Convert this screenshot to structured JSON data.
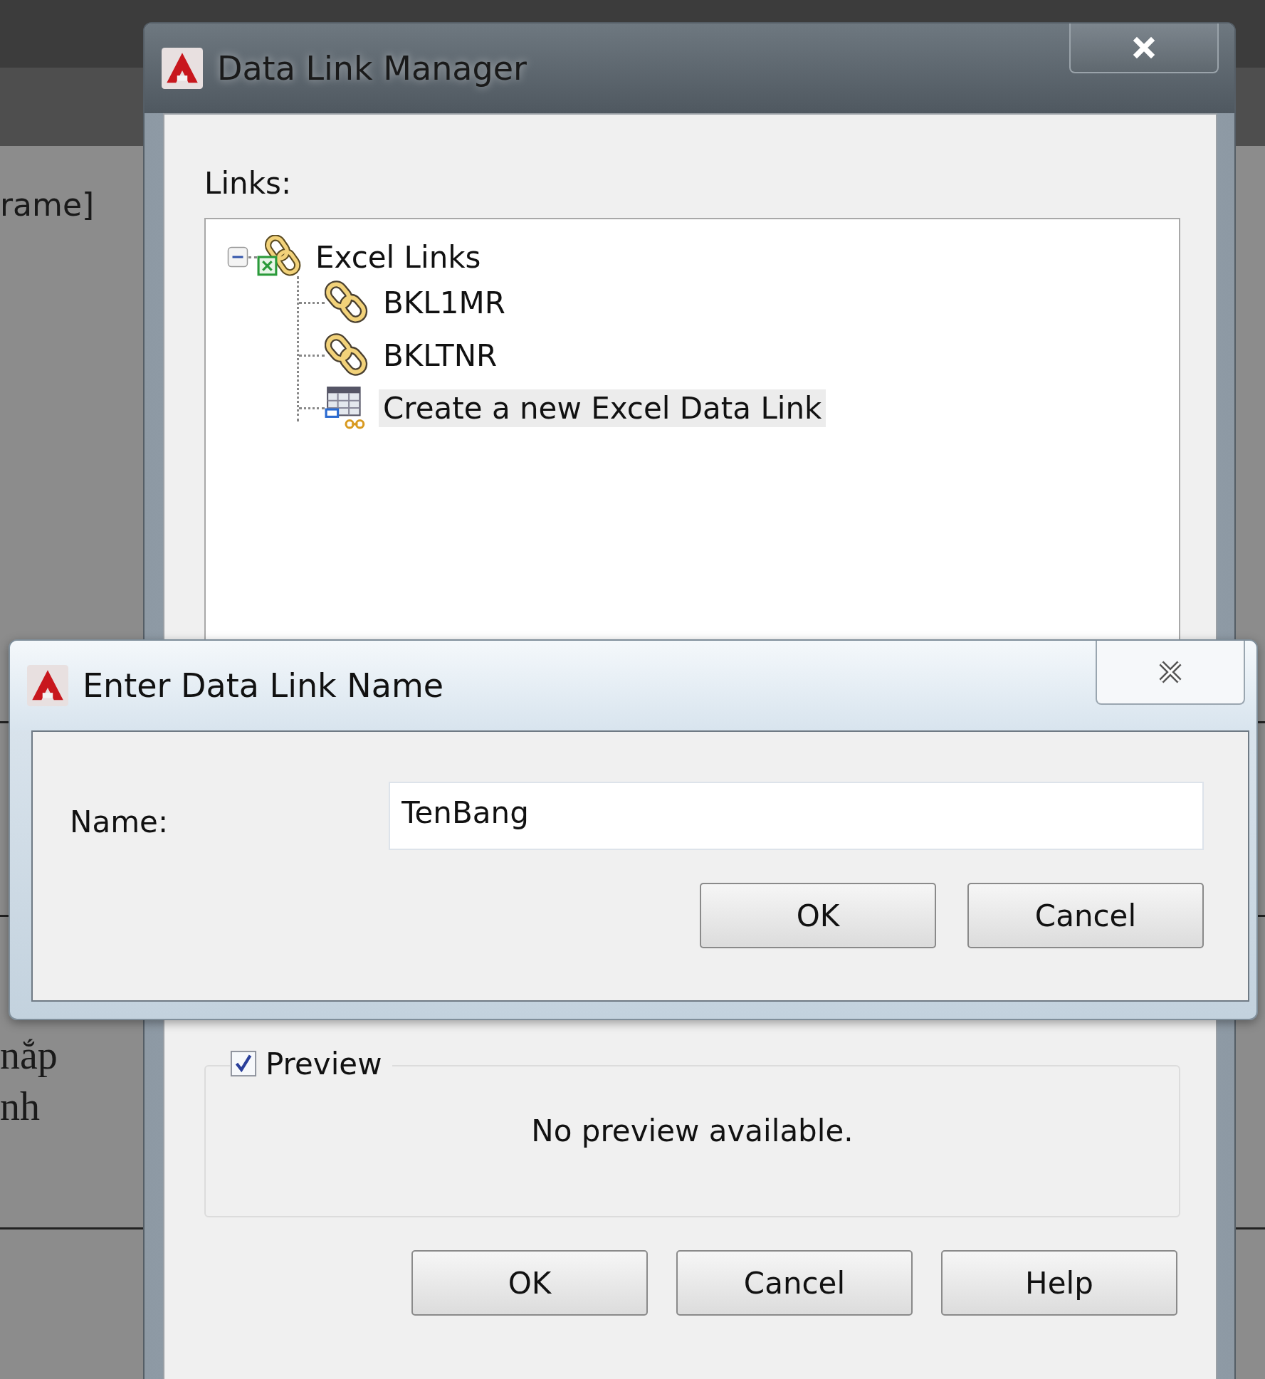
{
  "background": {
    "texts": [
      "rame]",
      "nắp",
      "nh"
    ]
  },
  "manager": {
    "title": "Data Link Manager",
    "links_label": "Links:",
    "tree": [
      {
        "label": "Excel Links",
        "kind": "group",
        "selected": false,
        "expanded": true,
        "children": [
          {
            "label": "BKL1MR",
            "kind": "link",
            "selected": false
          },
          {
            "label": "BKLTNR",
            "kind": "link",
            "selected": false
          },
          {
            "label": "Create a new Excel Data Link",
            "kind": "create",
            "selected": true
          }
        ]
      }
    ],
    "preview": {
      "label": "Preview",
      "checked": true,
      "message": "No preview available."
    },
    "buttons": [
      "OK",
      "Cancel",
      "Help"
    ]
  },
  "name_dialog": {
    "title": "Enter Data Link Name",
    "field_label": "Name:",
    "value": "TenBang",
    "buttons": [
      "OK",
      "Cancel"
    ]
  }
}
